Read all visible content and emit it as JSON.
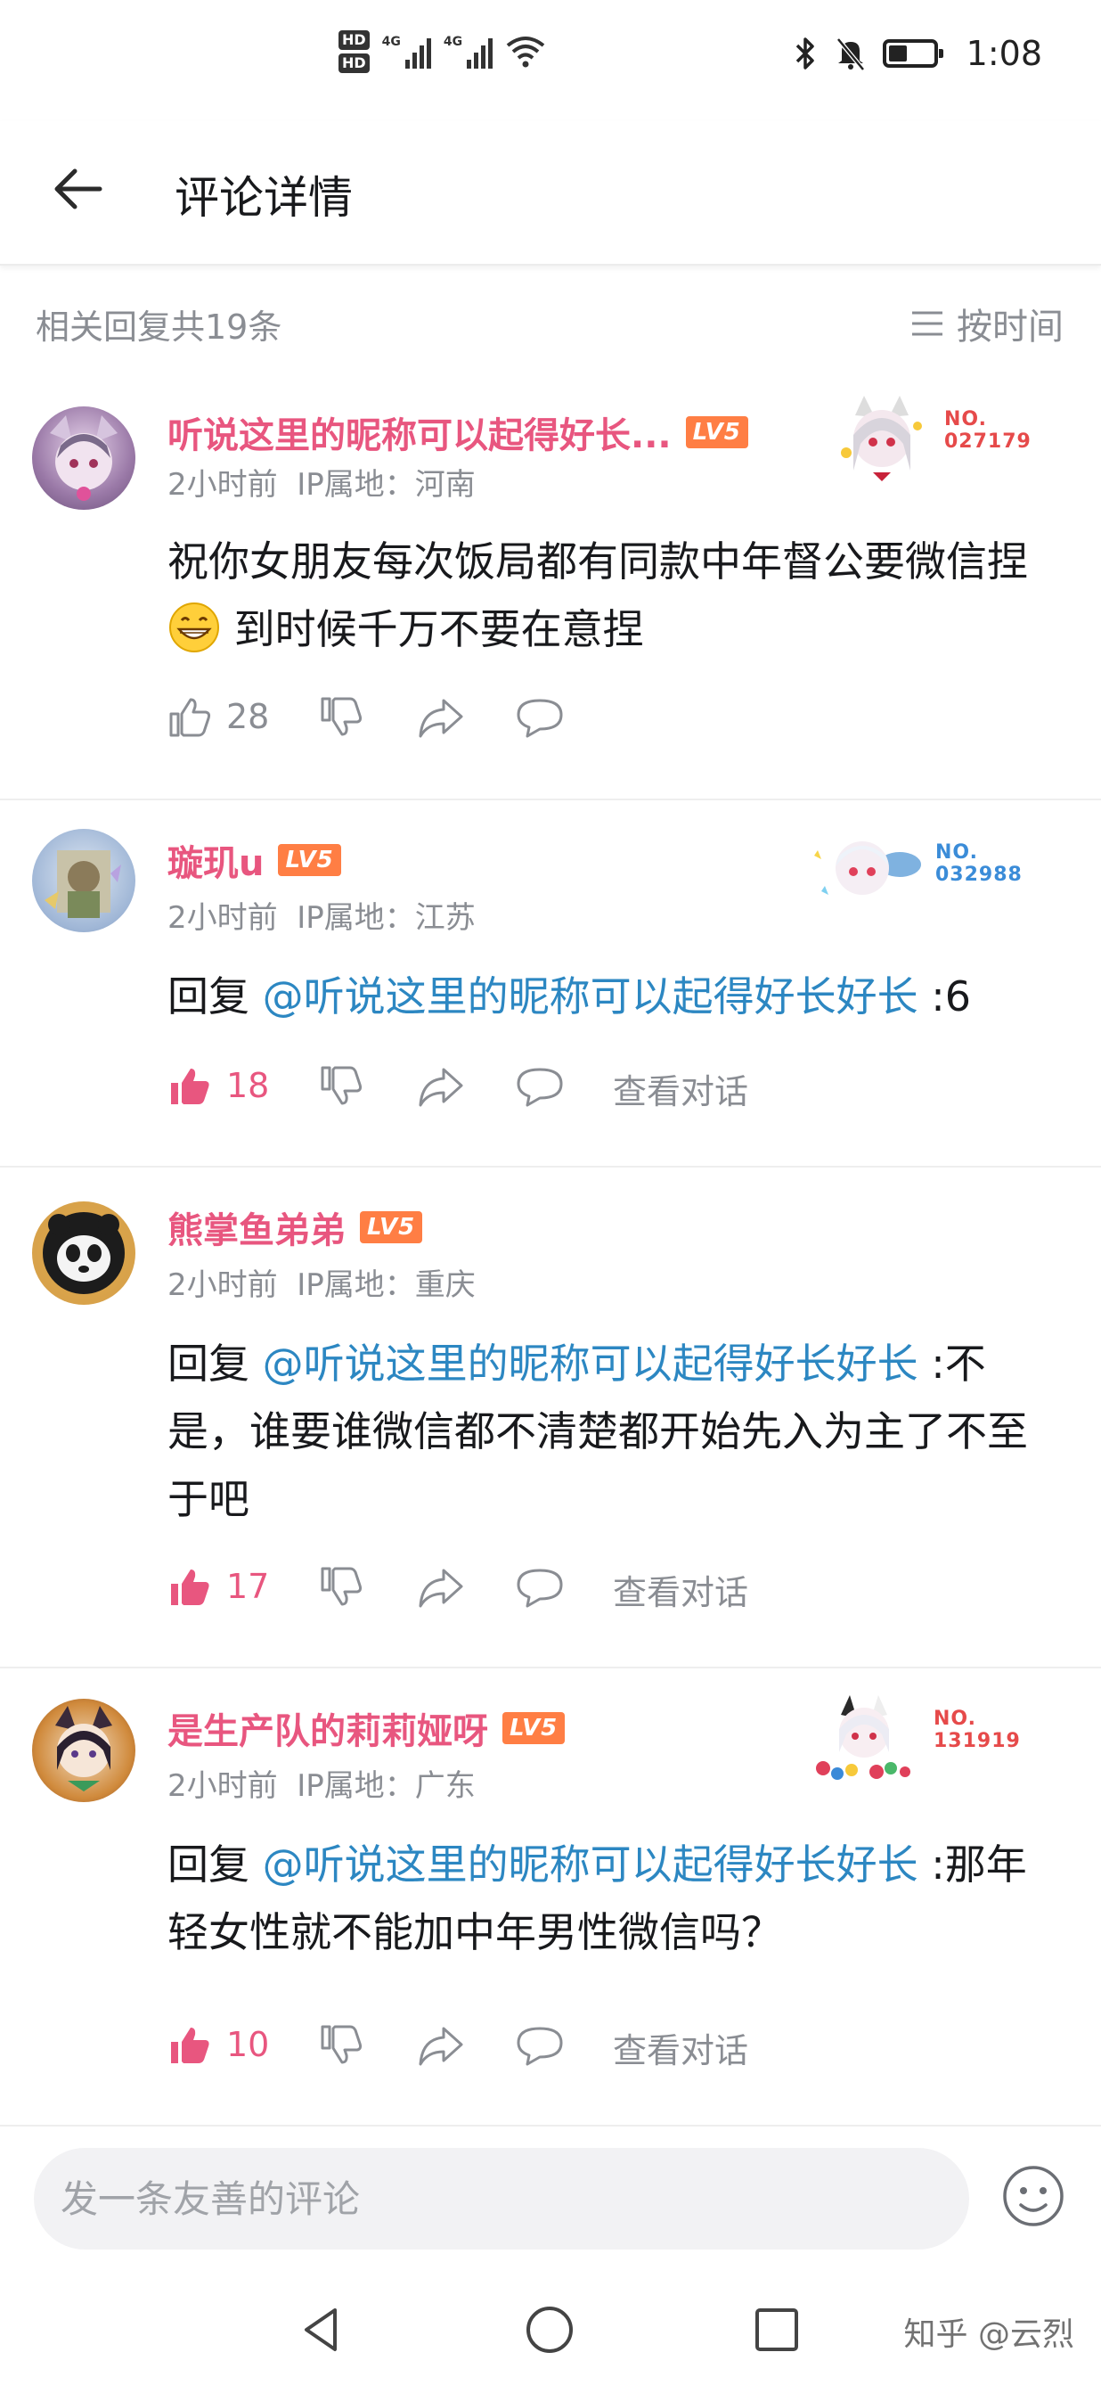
{
  "status_bar": {
    "hd1": "HD",
    "hd2": "HD",
    "net1": "4G",
    "net2": "4G",
    "time": "1:08"
  },
  "header": {
    "title": "评论详情"
  },
  "sub_header": {
    "reply_count": "相关回复共19条",
    "sort_label": "按时间"
  },
  "comments": [
    {
      "username": "听说这里的昵称可以起得好长...",
      "level": "LV5",
      "time": "2小时前",
      "ip": "IP属地：河南",
      "text_part1": "祝你女朋友每次饭局都有同款中年督公要微信捏",
      "text_part2": "到时候千万不要在意捏",
      "likes": "28",
      "badge_no": "NO.",
      "badge_num": "027179",
      "avatar_color": "#b8a8c8"
    },
    {
      "username": "璇玑u",
      "level": "LV5",
      "time": "2小时前",
      "ip": "IP属地：江苏",
      "reply_prefix": "回复 ",
      "mention": "@听说这里的昵称可以起得好长好长",
      "text": " :6",
      "likes": "18",
      "view_conversation": "查看对话",
      "badge_no": "NO.",
      "badge_num": "032988",
      "avatar_color": "#a6b9d6"
    },
    {
      "username": "熊掌鱼弟弟",
      "level": "LV5",
      "time": "2小时前",
      "ip": "IP属地：重庆",
      "reply_prefix": "回复 ",
      "mention": "@听说这里的昵称可以起得好长好长",
      "text": " :不是，谁要谁微信都不清楚都开始先入为主了不至于吧",
      "likes": "17",
      "view_conversation": "查看对话",
      "avatar_color": "#d9a34a"
    },
    {
      "username": "是生产队的莉莉娅呀",
      "level": "LV5",
      "time": "2小时前",
      "ip": "IP属地：广东",
      "reply_prefix": "回复 ",
      "mention": "@听说这里的昵称可以起得好长好长",
      "text": " :那年轻女性就不能加中年男性微信吗？",
      "likes": "10",
      "view_conversation": "查看对话",
      "badge_no": "NO.",
      "badge_num": "131919",
      "avatar_color": "#c98a4a"
    }
  ],
  "bottom_bar": {
    "input_placeholder": "发一条友善的评论"
  },
  "watermark": "知乎 @云烈",
  "colors": {
    "accent_pink": "#e8567f",
    "mention_blue": "#2c87c2",
    "level_orange": "#ff7e44",
    "muted_gray": "#8a8d93"
  }
}
